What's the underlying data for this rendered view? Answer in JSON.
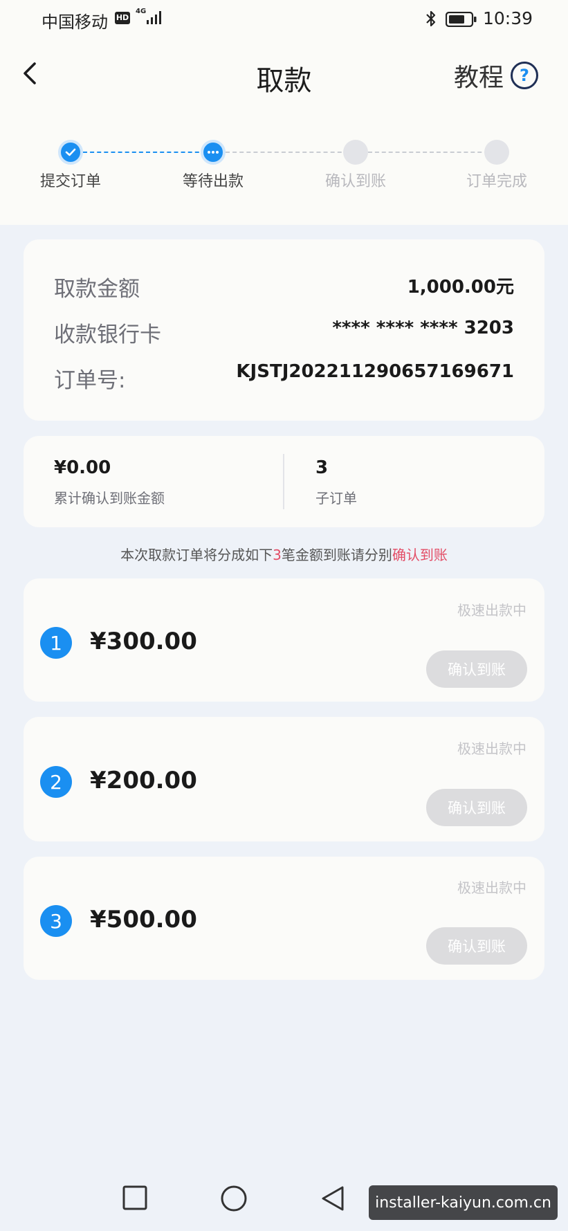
{
  "status_bar": {
    "carrier": "中国移动",
    "hd": "HD",
    "network": "4G",
    "time": "10:39"
  },
  "header": {
    "title": "取款",
    "tutorial": "教程",
    "help_glyph": "?"
  },
  "steps": [
    {
      "label": "提交订单",
      "state": "done"
    },
    {
      "label": "等待出款",
      "state": "current"
    },
    {
      "label": "确认到账",
      "state": "todo"
    },
    {
      "label": "订单完成",
      "state": "todo"
    }
  ],
  "order_info": {
    "amount_label": "取款金额",
    "amount_value": "1,000.00元",
    "card_label": "收款银行卡",
    "card_value": "**** **** **** 3203",
    "order_no_label": "订单号:",
    "order_no_value": "KJSTJ202211290657169671"
  },
  "stats": {
    "confirmed_amount": "¥0.00",
    "confirmed_label": "累计确认到账金额",
    "sub_orders_count": "3",
    "sub_orders_label": "子订单"
  },
  "notice": {
    "prefix": "本次取款订单将分成如下",
    "count": "3",
    "middle": "笔金额到账请分别",
    "action": "确认到账"
  },
  "sub_orders": [
    {
      "index": "1",
      "amount": "¥300.00",
      "status": "极速出款中",
      "button": "确认到账"
    },
    {
      "index": "2",
      "amount": "¥200.00",
      "status": "极速出款中",
      "button": "确认到账"
    },
    {
      "index": "3",
      "amount": "¥500.00",
      "status": "极速出款中",
      "button": "确认到账"
    }
  ],
  "watermark": "installer-kaiyun.com.cn",
  "colors": {
    "accent": "#1a8ff1",
    "highlight_red": "#e34d66",
    "disabled_button": "#dcdcde"
  },
  "icons": {
    "back": "chevron-left-icon",
    "help": "question-circle-icon",
    "nav_recent": "square-icon",
    "nav_home": "circle-icon",
    "nav_back": "triangle-back-icon"
  }
}
